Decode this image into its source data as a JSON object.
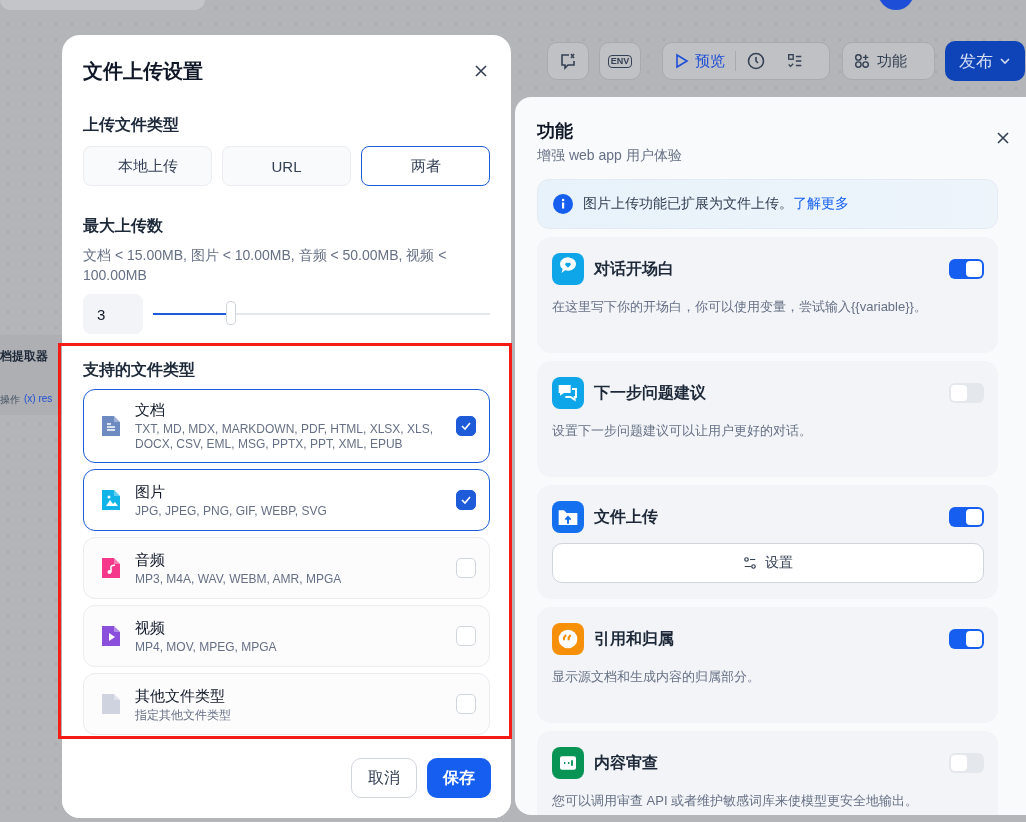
{
  "canvas": {
    "node_title": "档提取器",
    "breadcrumb": [
      "操作",
      "(x) res"
    ]
  },
  "toolbar": {
    "env_label": "ENV",
    "preview": "预览",
    "features": "功能",
    "publish": "发布"
  },
  "dialog": {
    "title": "文件上传设置",
    "upload_method": {
      "label": "上传文件类型",
      "options": [
        {
          "label": "本地上传",
          "selected": false
        },
        {
          "label": "URL",
          "selected": false
        },
        {
          "label": "两者",
          "selected": true
        }
      ]
    },
    "max_uploads": {
      "label": "最大上传数",
      "limits": "文档 < 15.00MB, 图片 < 10.00MB, 音频 < 50.00MB, 视频 < 100.00MB",
      "value": "3",
      "level": 0.23
    },
    "file_types": {
      "label": "支持的文件类型",
      "items": [
        {
          "kind": "document",
          "name": "文档",
          "extensions": "TXT, MD, MDX, MARKDOWN, PDF, HTML, XLSX, XLS, DOCX, CSV, EML, MSG, PPTX, PPT, XML, EPUB",
          "checked": true
        },
        {
          "kind": "image",
          "name": "图片",
          "extensions": "JPG, JPEG, PNG, GIF, WEBP, SVG",
          "checked": true
        },
        {
          "kind": "audio",
          "name": "音频",
          "extensions": "MP3, M4A, WAV, WEBM, AMR, MPGA",
          "checked": false
        },
        {
          "kind": "video",
          "name": "视频",
          "extensions": "MP4, MOV, MPEG, MPGA",
          "checked": false
        },
        {
          "kind": "other",
          "name": "其他文件类型",
          "extensions": "指定其他文件类型",
          "checked": false
        }
      ]
    },
    "buttons": {
      "cancel": "取消",
      "save": "保存"
    }
  },
  "panel": {
    "title": "功能",
    "subtitle": "增强 web app 用户体验",
    "notice": {
      "text": "图片上传功能已扩展为文件上传。",
      "link": "了解更多"
    },
    "features": [
      {
        "kind": "opener",
        "title": "对话开场白",
        "on": true,
        "description": "在这里写下你的开场白，你可以使用变量，尝试输入{{variable}}。"
      },
      {
        "kind": "suggestions",
        "title": "下一步问题建议",
        "on": false,
        "description": "设置下一步问题建议可以让用户更好的对话。"
      },
      {
        "kind": "upload",
        "title": "文件上传",
        "on": true,
        "action": "设置"
      },
      {
        "kind": "citation",
        "title": "引用和归属",
        "on": true,
        "description": "显示源文档和生成内容的归属部分。"
      },
      {
        "kind": "moderation",
        "title": "内容审查",
        "on": false,
        "description": "您可以调用审查 API 或者维护敏感词库来使模型更安全地输出。"
      }
    ]
  }
}
